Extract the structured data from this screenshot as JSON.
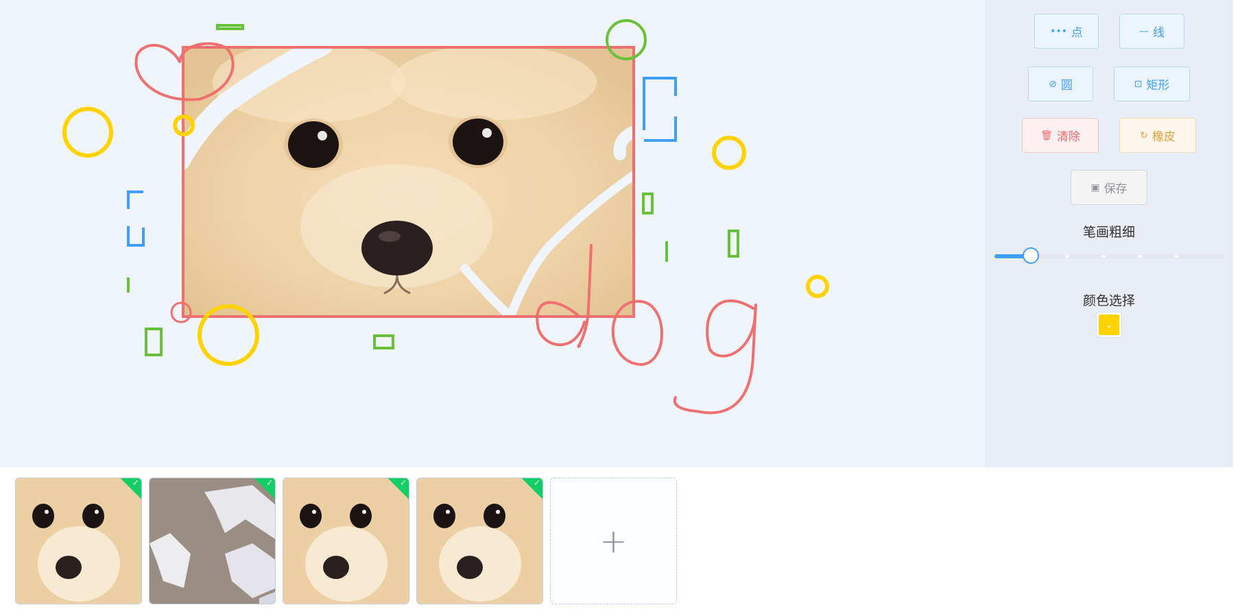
{
  "canvas": {
    "annotation_text": "dog",
    "colors": {
      "red": "#f07070",
      "yellow": "#ffd200",
      "green": "#67c23a",
      "blue": "#409eff",
      "eraser": "#f0f4fb"
    }
  },
  "toolbar": {
    "point": {
      "label": "点",
      "icon": "more-dots-icon"
    },
    "line": {
      "label": "线",
      "icon": "minus-icon"
    },
    "circle": {
      "label": "圆",
      "icon": "circle-check-icon"
    },
    "rect": {
      "label": "矩形",
      "icon": "crop-icon"
    },
    "clear": {
      "label": "清除",
      "icon": "delete-icon"
    },
    "eraser": {
      "label": "橡皮",
      "icon": "refresh-icon"
    },
    "save": {
      "label": "保存",
      "icon": "picture-icon"
    }
  },
  "stroke": {
    "label": "笔画粗细",
    "value": 2,
    "min": 1,
    "max": 7
  },
  "color_select": {
    "label": "颜色选择",
    "value": "#ffd200"
  },
  "thumbnails": [
    {
      "kind": "dog",
      "selected": true
    },
    {
      "kind": "paper",
      "selected": true
    },
    {
      "kind": "dog",
      "selected": true
    },
    {
      "kind": "dog",
      "selected": true
    }
  ],
  "upload": {
    "icon": "plus-icon",
    "symbol": "+"
  }
}
